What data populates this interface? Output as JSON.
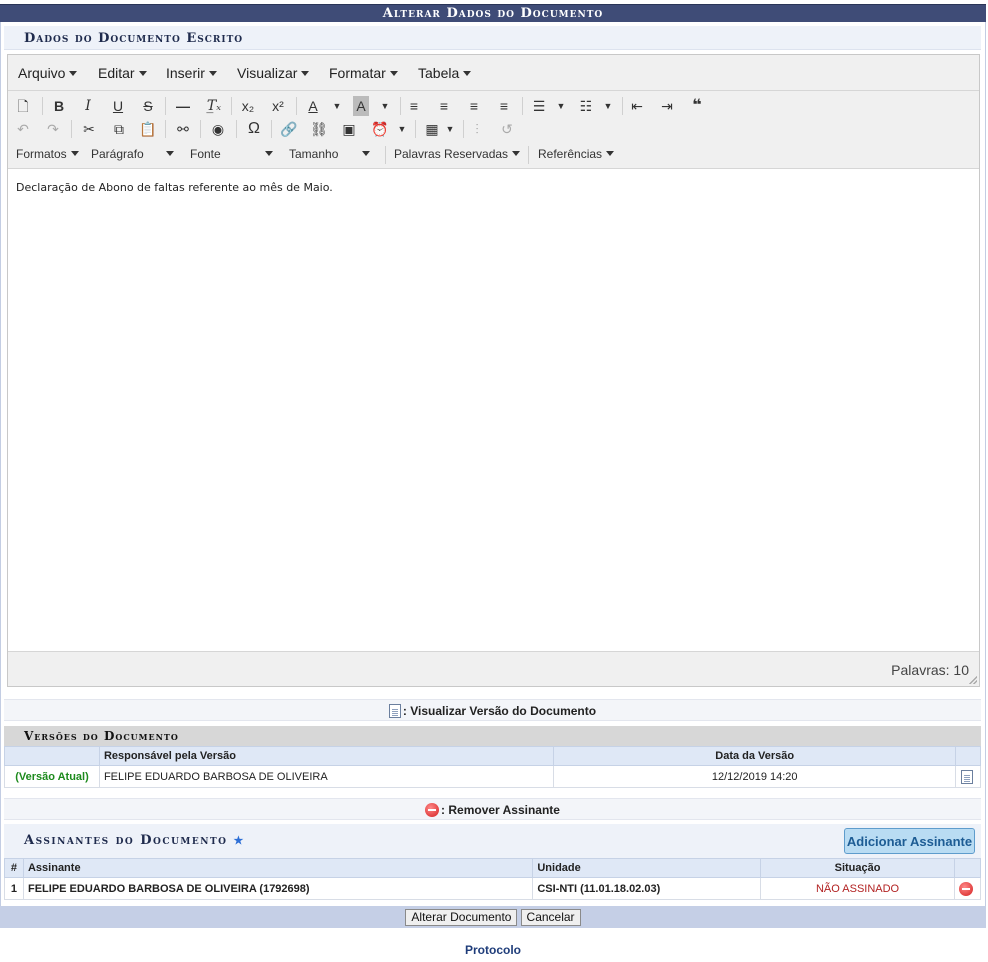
{
  "page": {
    "title": "Alterar Dados do Documento",
    "subtitle": "Dados do Documento Escrito"
  },
  "editor": {
    "menus": [
      "Arquivo",
      "Editar",
      "Inserir",
      "Visualizar",
      "Formatar",
      "Tabela"
    ],
    "format_dropdowns": [
      "Formatos",
      "Parágrafo",
      "Fonte",
      "Tamanho",
      "Palavras Reservadas",
      "Referências"
    ],
    "content": "Declaração de Abono de faltas referente ao mês de Maio.",
    "word_count": "Palavras: 10",
    "toolbar_icons_row1": [
      "new-document-icon",
      "bold-icon",
      "italic-icon",
      "underline-icon",
      "strikethrough-icon",
      "horizontal-line-icon",
      "clear-format-icon",
      "subscript-icon",
      "superscript-icon",
      "text-color-icon",
      "background-color-icon",
      "align-left-icon",
      "align-center-icon",
      "align-right-icon",
      "align-justify-icon",
      "bullet-list-icon",
      "numbered-list-icon",
      "outdent-icon",
      "indent-icon",
      "blockquote-icon"
    ],
    "toolbar_icons_row2": [
      "undo-icon",
      "redo-icon",
      "cut-icon",
      "copy-icon",
      "paste-icon",
      "find-icon",
      "preview-icon",
      "special-char-icon",
      "link-icon",
      "unlink-icon",
      "image-icon",
      "datetime-icon",
      "table-icon",
      "page-break-icon",
      "restore-icon"
    ]
  },
  "legend_view": ": Visualizar Versão do Documento",
  "versions": {
    "title": "Versões do Documento",
    "columns": [
      "",
      "Responsável pela Versão",
      "Data da Versão",
      ""
    ],
    "rows": [
      {
        "label": "(Versão Atual)",
        "responsavel": "FELIPE EDUARDO BARBOSA DE OLIVEIRA",
        "data": "12/12/2019 14:20"
      }
    ]
  },
  "legend_remove": ": Remover Assinante",
  "signers": {
    "title": "Assinantes do Documento",
    "star": "★",
    "add_button": "Adicionar Assinante",
    "columns": [
      "#",
      "Assinante",
      "Unidade",
      "Situação",
      ""
    ],
    "rows": [
      {
        "num": "1",
        "assinante": "FELIPE EDUARDO BARBOSA DE OLIVEIRA (1792698)",
        "unidade": "CSI-NTI (11.01.18.02.03)",
        "situacao": "NÃO ASSINADO"
      }
    ]
  },
  "buttons": {
    "submit": "Alterar Documento",
    "cancel": "Cancelar"
  },
  "footer": "Protocolo"
}
